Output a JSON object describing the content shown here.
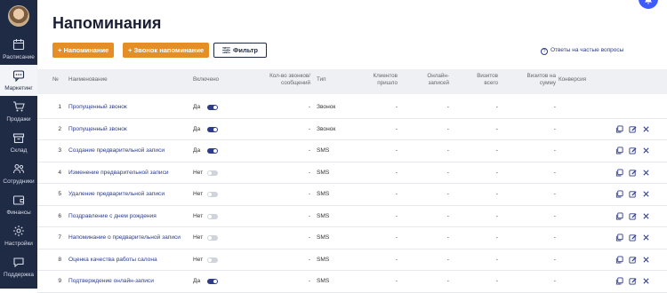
{
  "sidebar": {
    "items": [
      {
        "label": "Расписание",
        "icon": "calendar-icon"
      },
      {
        "label": "Маркетинг",
        "icon": "chat-icon",
        "active": true
      },
      {
        "label": "Продажи",
        "icon": "cart-icon"
      },
      {
        "label": "Склад",
        "icon": "box-icon"
      },
      {
        "label": "Сотрудники",
        "icon": "users-icon"
      },
      {
        "label": "Финансы",
        "icon": "wallet-icon"
      },
      {
        "label": "Настройки",
        "icon": "gear-icon"
      },
      {
        "label": "Поддержка",
        "icon": "chat-bubble-icon"
      }
    ]
  },
  "page": {
    "title": "Напоминания",
    "faq_link": "Ответы на частые вопросы"
  },
  "toolbar": {
    "add_reminder": "Напоминание",
    "add_call_reminder": "Звонок напоминание",
    "filter": "Фильтр"
  },
  "table": {
    "headers": {
      "num": "№",
      "name": "Наименование",
      "enabled": "Включено",
      "calls": "Кол-во звонков/ сообщений",
      "type": "Тип",
      "clients": "Клиентов пришло",
      "online": "Онлайн- записей",
      "visits": "Визитов всего",
      "visits_sum": "Визитов на сумму",
      "conversion": "Конверсия"
    },
    "rows": [
      {
        "num": "1",
        "name": "Пропущенный звонок",
        "enabled": "Да",
        "on": true,
        "calls": "-",
        "type": "Звонок",
        "clients": "-",
        "online": "-",
        "visits": "-",
        "visits_sum": "-",
        "actions": false
      },
      {
        "num": "2",
        "name": "Пропущенный звонок",
        "enabled": "Да",
        "on": true,
        "calls": "-",
        "type": "Звонок",
        "clients": "-",
        "online": "-",
        "visits": "-",
        "visits_sum": "-",
        "actions": true
      },
      {
        "num": "3",
        "name": "Создание предварительной записи",
        "enabled": "Да",
        "on": true,
        "calls": "-",
        "type": "SMS",
        "clients": "-",
        "online": "-",
        "visits": "-",
        "visits_sum": "-",
        "actions": true
      },
      {
        "num": "4",
        "name": "Изменение предварительной записи",
        "enabled": "Нет",
        "on": false,
        "calls": "-",
        "type": "SMS",
        "clients": "-",
        "online": "-",
        "visits": "-",
        "visits_sum": "-",
        "actions": true
      },
      {
        "num": "5",
        "name": "Удаление предварительной записи",
        "enabled": "Нет",
        "on": false,
        "calls": "-",
        "type": "SMS",
        "clients": "-",
        "online": "-",
        "visits": "-",
        "visits_sum": "-",
        "actions": true
      },
      {
        "num": "6",
        "name": "Поздравление с днем рождения",
        "enabled": "Нет",
        "on": false,
        "calls": "-",
        "type": "SMS",
        "clients": "-",
        "online": "-",
        "visits": "-",
        "visits_sum": "-",
        "actions": true
      },
      {
        "num": "7",
        "name": "Напоминание о предварительной записи",
        "enabled": "Нет",
        "on": false,
        "calls": "-",
        "type": "SMS",
        "clients": "-",
        "online": "-",
        "visits": "-",
        "visits_sum": "-",
        "actions": true
      },
      {
        "num": "8",
        "name": "Оценка качества работы салона",
        "enabled": "Нет",
        "on": false,
        "calls": "-",
        "type": "SMS",
        "clients": "-",
        "online": "-",
        "visits": "-",
        "visits_sum": "-",
        "actions": true
      },
      {
        "num": "9",
        "name": "Подтверждение онлайн-записи",
        "enabled": "Да",
        "on": true,
        "calls": "-",
        "type": "SMS",
        "clients": "-",
        "online": "-",
        "visits": "-",
        "visits_sum": "-",
        "actions": true
      }
    ]
  },
  "colors": {
    "sidebar": "#1f2a44",
    "accent": "#e58e26",
    "link": "#2d3b8c"
  }
}
